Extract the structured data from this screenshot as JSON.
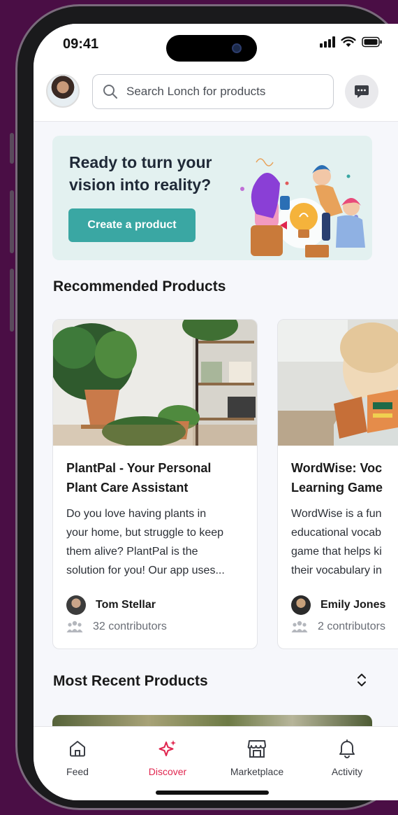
{
  "status": {
    "time": "09:41"
  },
  "search": {
    "placeholder": "Search Lonch for products"
  },
  "banner": {
    "title": "Ready to turn your vision into reality?",
    "button_label": "Create a product"
  },
  "sections": {
    "recommended": "Recommended Products",
    "recent": "Most Recent Products"
  },
  "products": [
    {
      "title": "PlantPal - Your Personal\nPlant Care Assistant",
      "description": "Do you love having plants in\nyour home, but struggle to keep\nthem alive? PlantPal is the\nsolution for you! Our app uses...",
      "author": "Tom Stellar",
      "contributors": "32 contributors"
    },
    {
      "title": "WordWise: Voc\nLearning Game",
      "description": "WordWise is a fun\neducational vocab\ngame that helps ki\ntheir vocabulary in",
      "author": "Emily Jones",
      "contributors": "2 contributors"
    }
  ],
  "tabs": [
    {
      "label": "Feed",
      "icon": "home-icon",
      "active": false
    },
    {
      "label": "Discover",
      "icon": "sparkle-icon",
      "active": true
    },
    {
      "label": "Marketplace",
      "icon": "store-icon",
      "active": false
    },
    {
      "label": "Activity",
      "icon": "bell-icon",
      "active": false
    }
  ],
  "colors": {
    "accent": "#e0264f",
    "primary_button": "#3aa7a3",
    "banner_bg": "#e3f1f0",
    "background": "#4a0e45"
  }
}
